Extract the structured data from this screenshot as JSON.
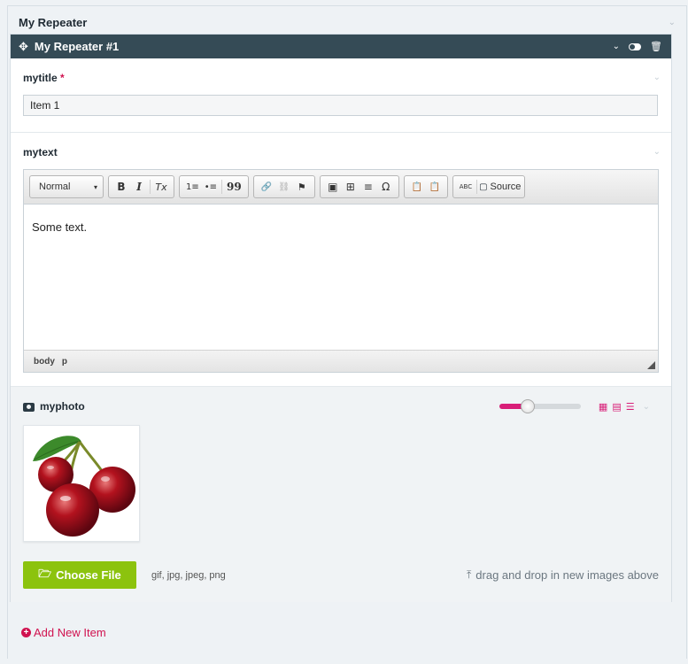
{
  "repeater": {
    "title": "My Repeater",
    "item": {
      "title": "My Repeater #1",
      "fields": {
        "title": {
          "label": "mytitle",
          "required_mark": "*",
          "value": "Item 1"
        },
        "text": {
          "label": "mytext",
          "format": "Normal",
          "toolbar": {
            "bold": "B",
            "italic": "I",
            "clear_format": "Tx",
            "numbered_list": "1≡",
            "bulleted_list": "•≡",
            "blockquote": "99",
            "link": "🔗",
            "unlink": "⛓",
            "anchor": "⚑",
            "image": "▣",
            "table": "⊞",
            "hr": "≡",
            "special_char": "Ω",
            "paste_text": "📋",
            "paste_word": "📋",
            "spellcheck": "ABC",
            "source": "Source"
          },
          "content": "Some text.",
          "path": [
            "body",
            "p"
          ]
        },
        "photo": {
          "label": "myphoto",
          "thumb_size_level": 0.35,
          "choose_file": "Choose File",
          "extensions": "gif, jpg, jpeg, png",
          "drop_hint": "drag and drop in new images above"
        }
      }
    },
    "add_new": "Add New Item"
  },
  "colors": {
    "accent": "#d81e78",
    "bar": "#354b56",
    "button": "#8cc30e"
  }
}
